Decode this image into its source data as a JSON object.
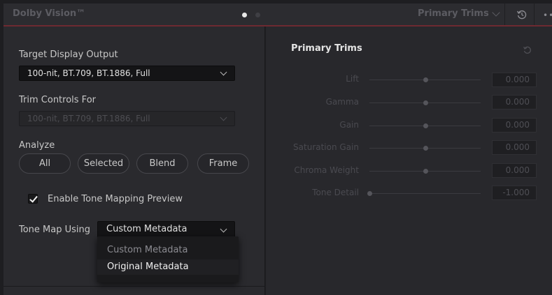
{
  "header": {
    "title": "Dolby Vision™",
    "mode_label": "Primary Trims",
    "more_label": "••"
  },
  "left": {
    "target_label": "Target Display Output",
    "target_value": "100-nit, BT.709, BT.1886, Full",
    "trim_for_label": "Trim Controls For",
    "trim_for_value": "100-nit, BT.709, BT.1886, Full",
    "analyze_label": "Analyze",
    "analyze_buttons": [
      "All",
      "Selected",
      "Blend",
      "Frame"
    ],
    "tone_mapping_preview_label": "Enable Tone Mapping Preview",
    "tone_mapping_preview_checked": true,
    "tone_map_using_label": "Tone Map Using",
    "tone_map_using_value": "Custom Metadata",
    "tone_map_options": [
      "Custom Metadata",
      "Original Metadata"
    ]
  },
  "trims": {
    "title": "Primary Trims",
    "rows": [
      {
        "label": "Lift",
        "value": "0.000",
        "position": 0.5
      },
      {
        "label": "Gamma",
        "value": "0.000",
        "position": 0.5
      },
      {
        "label": "Gain",
        "value": "0.000",
        "position": 0.5
      },
      {
        "label": "Saturation Gain",
        "value": "0.000",
        "position": 0.5
      },
      {
        "label": "Chroma Weight",
        "value": "0.000",
        "position": 0.5
      },
      {
        "label": "Tone Detail",
        "value": "-1.000",
        "position": 0.0
      }
    ]
  },
  "colors": {
    "accent_line": "#6e2a31",
    "panel": "#2a2a2e",
    "text": "#c8c8c8",
    "disabled_text": "#4a4a50"
  },
  "icons": {
    "header_reset": "history-reset-icon",
    "trims_reset": "reset-icon",
    "checkbox": "checkmark-icon"
  }
}
